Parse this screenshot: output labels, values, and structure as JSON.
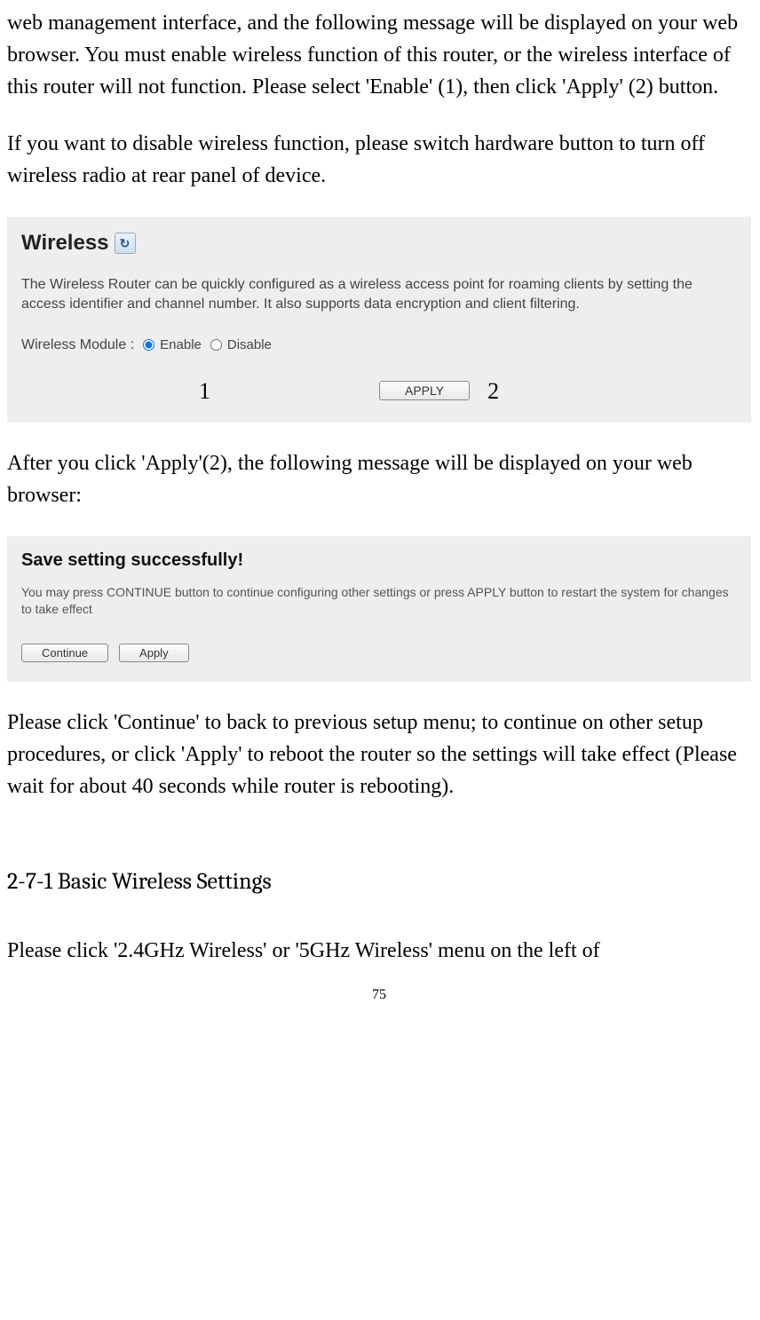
{
  "intro_para1": "web management interface, and the following message will be displayed on your web browser. You must enable wireless function of this router, or the wireless interface of this router will not function. Please select 'Enable' (1), then click 'Apply' (2) button.",
  "intro_para2": "If you want to disable wireless function, please switch hardware button to turn off wireless radio at rear panel of device.",
  "fig1": {
    "title": "Wireless",
    "desc": "The Wireless Router can be quickly configured as a wireless access point for roaming clients by setting the access identifier and channel number. It also supports data encryption and client filtering.",
    "module_label": "Wireless Module :",
    "enable": "Enable",
    "disable": "Disable",
    "apply": "APPLY",
    "callout1": "1",
    "callout2": "2"
  },
  "after_apply": "After you click 'Apply'(2), the following message will be displayed on your web browser:",
  "fig2": {
    "title": "Save setting successfully!",
    "desc": "You may press CONTINUE button to continue configuring other settings or press APPLY button to restart the system for changes to take effect",
    "continue": "Continue",
    "apply": "Apply"
  },
  "continue_para": "Please click 'Continue' to back to previous setup menu; to continue on other setup procedures, or click 'Apply' to reboot the router so the settings will take effect (Please wait for about 40 seconds while router is rebooting).",
  "section_heading": "2-7-1 Basic Wireless Settings",
  "last_para": "Please click '2.4GHz Wireless' or '5GHz Wireless' menu on the left of",
  "page_number": "75"
}
